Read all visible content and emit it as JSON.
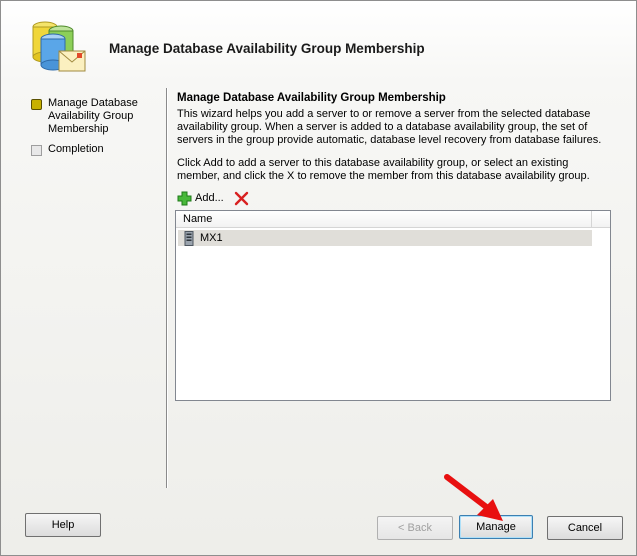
{
  "window": {
    "title": "Manage Database Availability Group Membership"
  },
  "steps": [
    {
      "label": "Manage Database Availability Group Membership",
      "state": "active"
    },
    {
      "label": "Completion",
      "state": "pending"
    }
  ],
  "content": {
    "title": "Manage Database Availability Group Membership",
    "description": "This wizard helps you add a server to or remove a server from the selected database availability group. When a server is added to a database availability group, the set of servers in the group provide automatic, database level recovery from database failures.",
    "instructions": "Click Add to add a server to this database availability group, or select an existing member, and click the X to remove the member from this database availability group."
  },
  "toolbar": {
    "add_label": "Add...",
    "add_icon": "green-plus-icon",
    "remove_icon": "red-x-icon"
  },
  "list": {
    "columns": [
      "Name"
    ],
    "rows": [
      {
        "name": "MX1",
        "icon": "server-icon",
        "selected": true
      }
    ]
  },
  "buttons": {
    "help": "Help",
    "back": "< Back",
    "manage": "Manage",
    "cancel": "Cancel"
  },
  "colors": {
    "annotation_arrow": "#e81010",
    "active_step": "#c7b100",
    "selected_row": "#e0ded9"
  }
}
